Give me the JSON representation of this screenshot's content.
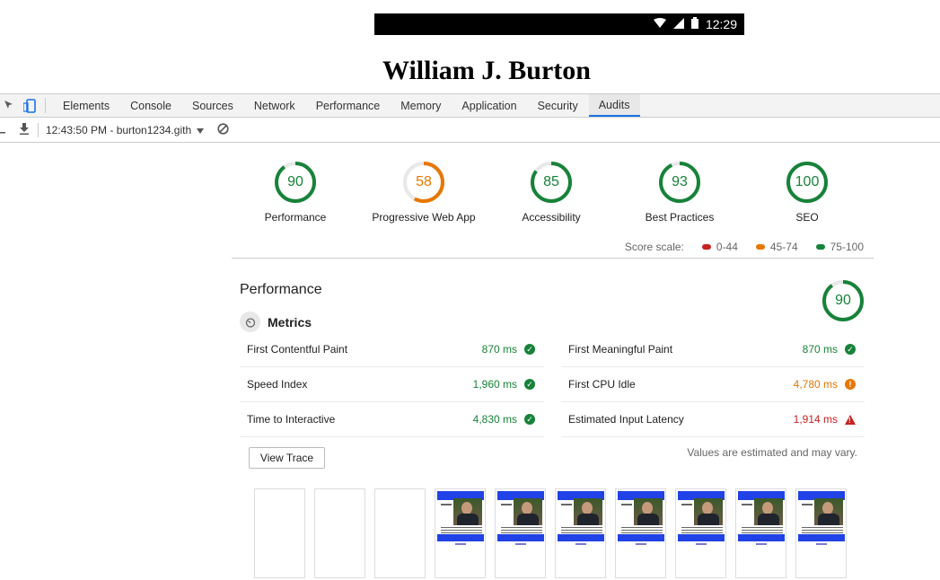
{
  "colors": {
    "pass": "#178239",
    "average": "#e67700",
    "fail": "#c7221f",
    "accent": "#1a73e8"
  },
  "device": {
    "status_time": "12:29",
    "icons": [
      "wifi-icon",
      "cell-signal-icon",
      "battery-icon"
    ],
    "page_heading": "William J. Burton"
  },
  "devtools": {
    "tabs": [
      "Elements",
      "Console",
      "Sources",
      "Network",
      "Performance",
      "Memory",
      "Application",
      "Security",
      "Audits"
    ],
    "active_tab": "Audits"
  },
  "audit_toolbar": {
    "report_selector": "12:43:50 PM - burton1234.gith",
    "icons": [
      "download-icon",
      "dropdown-arrow-icon",
      "clear-icon"
    ]
  },
  "categories": [
    {
      "score": 90,
      "label": "Performance",
      "rating": "pass"
    },
    {
      "score": 58,
      "label": "Progressive Web App",
      "rating": "average"
    },
    {
      "score": 85,
      "label": "Accessibility",
      "rating": "pass"
    },
    {
      "score": 93,
      "label": "Best Practices",
      "rating": "pass"
    },
    {
      "score": 100,
      "label": "SEO",
      "rating": "pass"
    }
  ],
  "score_scale": {
    "label": "Score scale:",
    "ranges": [
      {
        "text": "0-44",
        "color": "#c7221f"
      },
      {
        "text": "45-74",
        "color": "#e67700"
      },
      {
        "text": "75-100",
        "color": "#178239"
      }
    ]
  },
  "performance": {
    "title": "Performance",
    "score": 90,
    "metrics_title": "Metrics",
    "metrics": [
      {
        "name": "First Contentful Paint",
        "value": "870 ms",
        "rating": "pass"
      },
      {
        "name": "First Meaningful Paint",
        "value": "870 ms",
        "rating": "pass"
      },
      {
        "name": "Speed Index",
        "value": "1,960 ms",
        "rating": "pass"
      },
      {
        "name": "First CPU Idle",
        "value": "4,780 ms",
        "rating": "average"
      },
      {
        "name": "Time to Interactive",
        "value": "4,830 ms",
        "rating": "pass"
      },
      {
        "name": "Estimated Input Latency",
        "value": "1,914 ms",
        "rating": "fail"
      }
    ],
    "view_trace_label": "View Trace",
    "note": "Values are estimated and may vary.",
    "filmstrip": [
      "blank",
      "blank",
      "blank",
      "loaded",
      "loaded",
      "loaded",
      "loaded",
      "loaded",
      "loaded",
      "loaded"
    ]
  }
}
